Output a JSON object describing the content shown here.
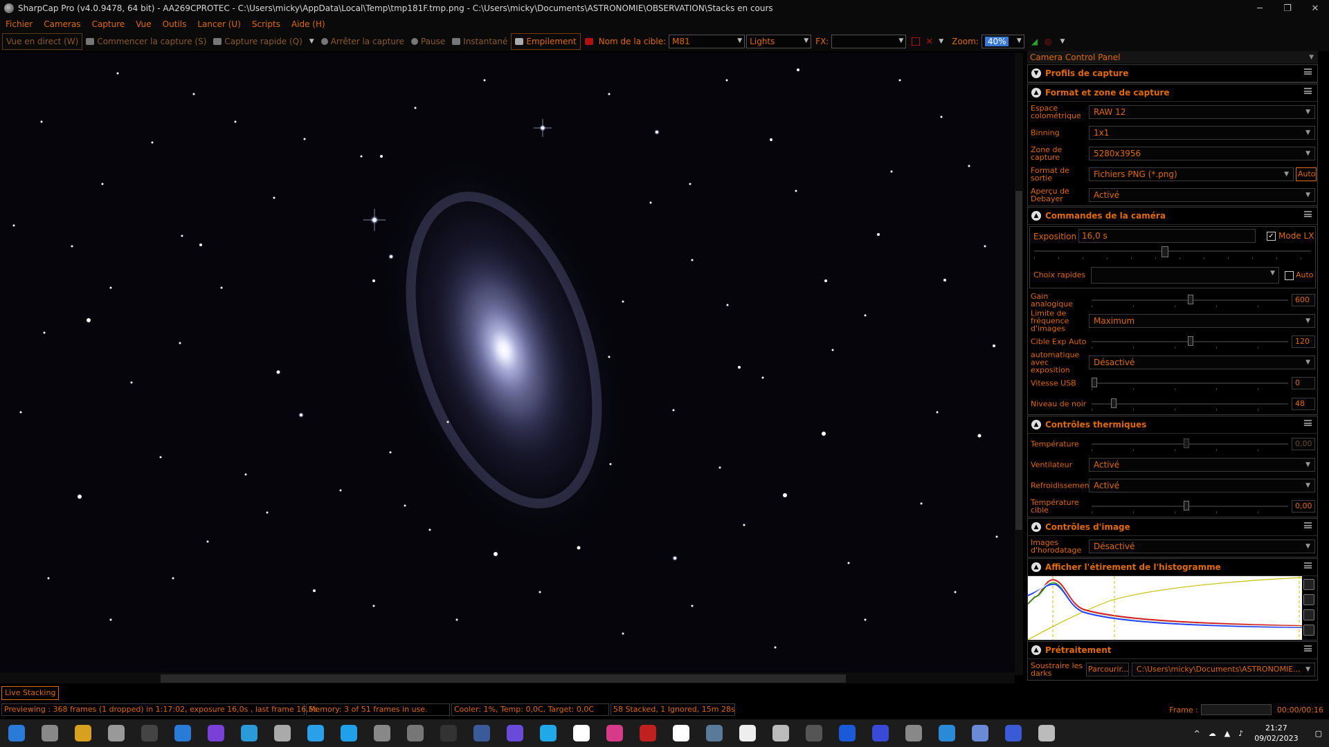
{
  "window": {
    "title": "SharpCap Pro (v4.0.9478, 64 bit) - AA269CPROTEC - C:\\Users\\micky\\AppData\\Local\\Temp\\tmp181F.tmp.png - C:\\Users\\micky\\Documents\\ASTRONOMIE\\OBSERVATION\\Stacks en cours",
    "controls": [
      "─",
      "❐",
      "✕"
    ]
  },
  "menu": [
    "Fichier",
    "Cameras",
    "Capture",
    "Vue",
    "Outils",
    "Lancer (U)",
    "Scripts",
    "Aide (H)"
  ],
  "toolbar": {
    "live_view": "Vue en direct (W)",
    "start_capture": "Commencer la capture (S)",
    "quick_capture": "Capture rapide (Q)",
    "stop_capture": "Arrêter la capture",
    "pause": "Pause",
    "snapshot": "Instantané",
    "stacking": "Empilement",
    "target_label": "Nom de la cible:",
    "target_value": "M81",
    "frame_type": "Lights",
    "fx_label": "FX:",
    "fx_value": "",
    "zoom_label": "Zoom:",
    "zoom_value": "40%"
  },
  "panel": {
    "title": "Camera Control Panel",
    "sections": {
      "profiles": "Profils de capture",
      "format": "Format et zone de capture",
      "commands": "Commandes de la caméra",
      "thermal": "Contrôles thermiques",
      "image": "Contrôles d'image",
      "histogram": "Afficher l'étirement de l'histogramme",
      "preprocess": "Prétraitement"
    },
    "format_rows": {
      "colorspace_label": "Espace colométrique",
      "colorspace_value": "RAW 12",
      "binning_label": "Binning",
      "binning_value": "1x1",
      "zone_label": "Zone de capture",
      "zone_value": "5280x3956",
      "output_label": "Format de sortie",
      "output_value": "Fichiers PNG (*.png)",
      "output_auto": "Auto",
      "debayer_label": "Aperçu de Debayer",
      "debayer_value": "Activé"
    },
    "commands_rows": {
      "exposure_label": "Exposition",
      "exposure_value": "16,0 s",
      "lx_mode": "Mode LX",
      "lx_checked": true,
      "quick_label": "Choix rapides",
      "quick_auto": "Auto",
      "gain_label": "Gain analogique",
      "gain_value": "600",
      "gain_level": 0.5,
      "fps_label": "Limite de fréquence d'images",
      "fps_value": "Maximum",
      "autoexp_label": "Cible Exp Auto",
      "autoexp_value": "120",
      "autoexp_level": 0.5,
      "autoexpmode_label": "automatique avec exposition",
      "autoexpmode_value": "Désactivé",
      "usb_label": "Vitesse USB",
      "usb_value": "0",
      "usb_level": 0.0,
      "black_label": "Niveau de noir",
      "black_value": "48",
      "black_level": 0.1
    },
    "thermal_rows": {
      "temp_label": "Température",
      "temp_value": "0,00",
      "fan_label": "Ventilateur",
      "fan_value": "Activé",
      "cooling_label": "Refroidissement",
      "cooling_value": "Activé",
      "target_label": "Température cible",
      "target_value": "0,00"
    },
    "image_rows": {
      "timestamp_label": "Images d'horodatage",
      "timestamp_value": "Désactivé"
    },
    "preprocess_rows": {
      "darks_label": "Soustraire les darks",
      "browse": "Parcourir...",
      "path": "C:\\Users\\micky\\Documents\\ASTRONOMIE..."
    }
  },
  "live_stacking": "Live Stacking",
  "status": {
    "preview": "Previewing : 368 frames (1 dropped) in 1:17:02, exposure 16,0s , last frame 16,5s",
    "memory": "Memory: 3 of 51 frames in use.",
    "cooler": "Cooler: 1%, Temp: 0,0C, Target: 0,0C",
    "stacked": "58 Stacked, 1 Ignored, 15m 28s",
    "frame_label": "Frame :",
    "frame_time": "00:00/00:16"
  },
  "taskbar": {
    "time": "21:27",
    "date": "09/02/2023",
    "icons": [
      "windows-start",
      "task-view",
      "file-explorer",
      "settings",
      "notion",
      "mail",
      "messenger",
      "edge",
      "app",
      "app",
      "app",
      "app",
      "sharpcap",
      "app",
      "app",
      "app",
      "app",
      "app",
      "app",
      "app",
      "app",
      "app",
      "app",
      "app",
      "app",
      "app",
      "app",
      "app",
      "app",
      "app",
      "app",
      "app"
    ]
  }
}
